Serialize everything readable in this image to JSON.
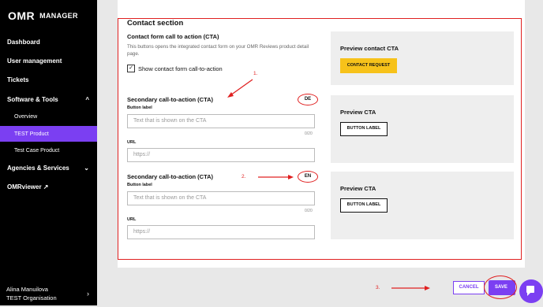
{
  "sidebar": {
    "logo": "OMR",
    "logo_sub": "MANAGER",
    "items": [
      {
        "label": "Dashboard"
      },
      {
        "label": "User management"
      },
      {
        "label": "Tickets"
      },
      {
        "label": "Software & Tools",
        "chevron": "^"
      },
      {
        "label": "Overview"
      },
      {
        "label": "TEST Product"
      },
      {
        "label": "Test Case Product"
      },
      {
        "label": "Agencies & Services",
        "chevron": "⌄"
      },
      {
        "label": "OMRviewer ↗"
      }
    ],
    "user_name": "Alina Manuilova",
    "org": "TEST Organisation",
    "user_chevron": "›"
  },
  "form": {
    "section_title": "Contact section",
    "cta_heading": "Contact form call to action (CTA)",
    "cta_description": "This buttons opens the integrated contact form on your OMR Reviews product detail page.",
    "checkbox_label": "Show contact form call-to-action",
    "secondary_heading": "Secondary call-to-action (CTA)",
    "button_label_caption": "Button label",
    "button_label_placeholder": "Text that is shown on the CTA",
    "counter": "0/20",
    "url_caption": "URL",
    "url_placeholder": "https://",
    "lang_de": "DE",
    "lang_en": "EN"
  },
  "preview": {
    "contact_title": "Preview contact CTA",
    "contact_button": "CONTACT REQUEST",
    "cta_title": "Preview CTA",
    "cta_button": "BUTTON LABEL"
  },
  "annotations": {
    "one": "1.",
    "two": "2.",
    "three": "3."
  },
  "footer": {
    "cancel": "CANCEL",
    "save": "SAVE"
  },
  "colors": {
    "accent": "#7b3ff2",
    "highlight": "#e02020",
    "cta_yellow": "#f7c21a"
  }
}
